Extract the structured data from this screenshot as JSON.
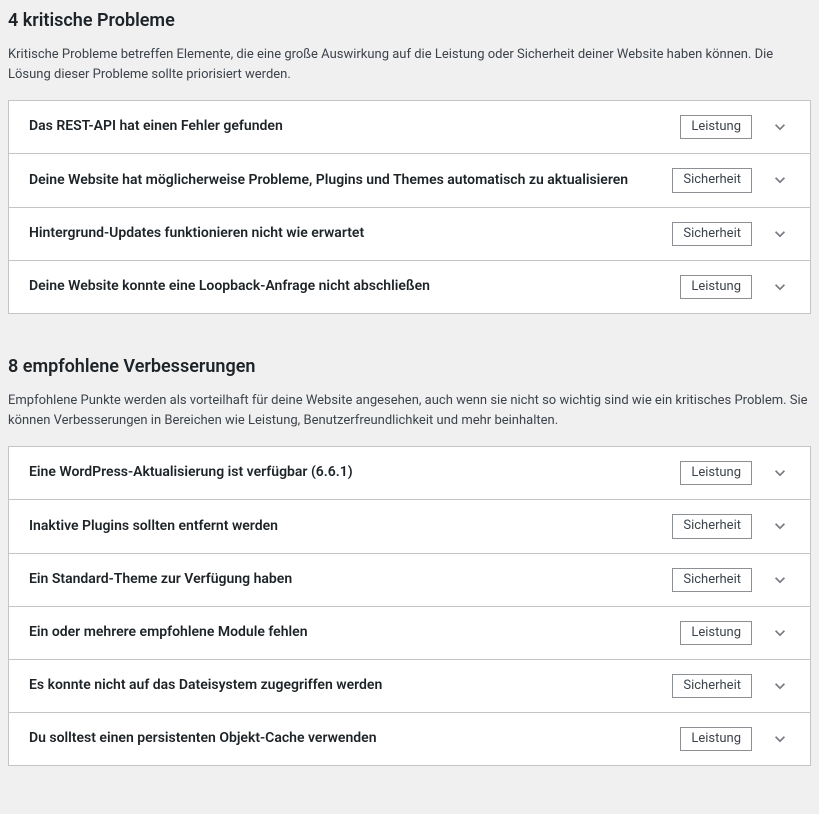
{
  "critical": {
    "heading": "4 kritische Probleme",
    "description": "Kritische Probleme betreffen Elemente, die eine große Auswirkung auf die Leistung oder Sicherheit deiner Website haben können. Die Lösung dieser Probleme sollte priorisiert werden.",
    "items": [
      {
        "title": "Das REST-API hat einen Fehler gefunden",
        "badge": "Leistung"
      },
      {
        "title": "Deine Website hat möglicherweise Probleme, Plugins und Themes automatisch zu aktualisieren",
        "badge": "Sicherheit"
      },
      {
        "title": "Hintergrund-Updates funktionieren nicht wie erwartet",
        "badge": "Sicherheit"
      },
      {
        "title": "Deine Website konnte eine Loopback-Anfrage nicht abschließen",
        "badge": "Leistung"
      }
    ]
  },
  "recommended": {
    "heading": "8 empfohlene Verbesserungen",
    "description": "Empfohlene Punkte werden als vorteilhaft für deine Website angesehen, auch wenn sie nicht so wichtig sind wie ein kritisches Problem. Sie können Verbesserungen in Bereichen wie Leistung, Benutzerfreundlichkeit und mehr beinhalten.",
    "items": [
      {
        "title": "Eine WordPress-Aktualisierung ist verfügbar (6.6.1)",
        "badge": "Leistung"
      },
      {
        "title": "Inaktive Plugins sollten entfernt werden",
        "badge": "Sicherheit"
      },
      {
        "title": "Ein Standard-Theme zur Verfügung haben",
        "badge": "Sicherheit"
      },
      {
        "title": "Ein oder mehrere empfohlene Module fehlen",
        "badge": "Leistung"
      },
      {
        "title": "Es konnte nicht auf das Dateisystem zugegriffen werden",
        "badge": "Sicherheit"
      },
      {
        "title": "Du solltest einen persistenten Objekt-Cache verwenden",
        "badge": "Leistung"
      }
    ]
  }
}
